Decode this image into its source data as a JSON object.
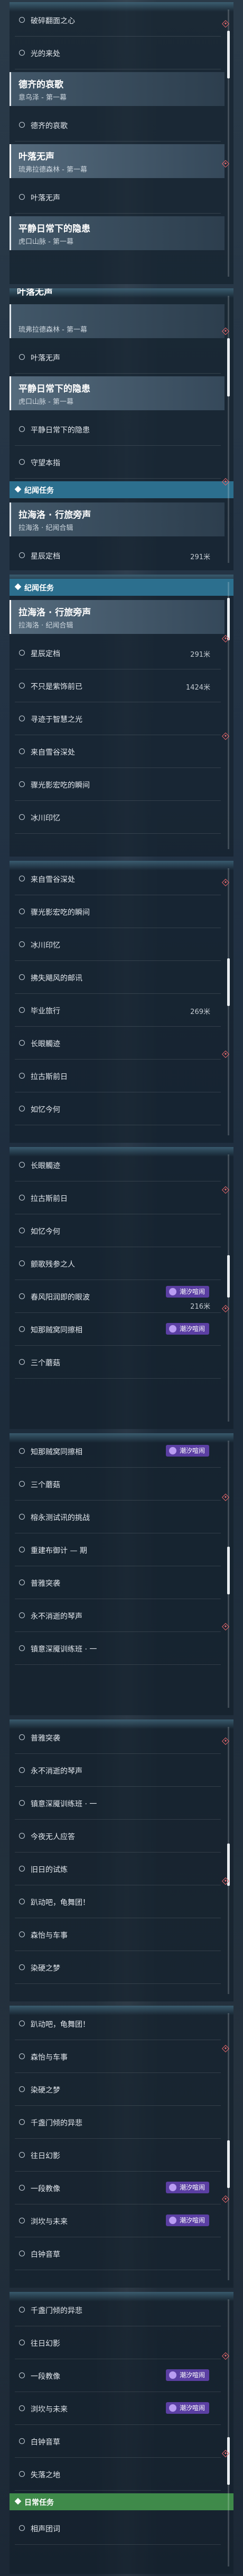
{
  "panels": [
    {
      "id": "p1",
      "rows": [
        {
          "type": "quest",
          "label": "破碎翻面之心"
        },
        {
          "type": "quest",
          "label": "光的来处"
        },
        {
          "type": "card",
          "title": "德齐的哀歌",
          "sub": "意乌泽 - 第一幕",
          "active": false
        },
        {
          "type": "quest",
          "label": "德齐的哀歌"
        },
        {
          "type": "card",
          "title": "叶落无声",
          "sub": "琉弗拉德森林 - 第一幕",
          "active": true
        },
        {
          "type": "quest",
          "label": "叶落无声"
        },
        {
          "type": "card",
          "title": "平静日常下的隐患",
          "sub": "虎口山脉 - 第一幕",
          "active": false
        }
      ]
    },
    {
      "id": "p2",
      "cap": "叶落无声",
      "rows": [
        {
          "type": "card",
          "title": "",
          "sub": "琉弗拉德森林 - 第一幕",
          "active": false
        },
        {
          "type": "quest",
          "label": "叶落无声"
        },
        {
          "type": "card",
          "title": "平静日常下的隐患",
          "sub": "虎口山脉 - 第一幕",
          "active": true
        },
        {
          "type": "quest",
          "label": "平静日常下的隐患"
        },
        {
          "type": "quest",
          "label": "守望本指"
        },
        {
          "type": "header",
          "label": "纪闻任务",
          "color": "blue"
        },
        {
          "type": "card",
          "title": "拉海洛 · 行旅旁声",
          "sub": "拉海洛 · 纪闻合辑",
          "active": false
        },
        {
          "type": "quest",
          "label": "星辰定档",
          "dist": "291米"
        }
      ]
    },
    {
      "id": "p3",
      "rows": [
        {
          "type": "header",
          "label": "纪闻任务",
          "color": "blue"
        },
        {
          "type": "card",
          "title": "拉海洛 · 行旅旁声",
          "sub": "拉海洛 · 纪闻合辑",
          "active": true
        },
        {
          "type": "quest",
          "label": "星辰定档",
          "dist": "291米"
        },
        {
          "type": "quest",
          "label": "不只是紫饰前已",
          "dist": "1424米"
        },
        {
          "type": "quest",
          "label": "寻迹于智慧之光"
        },
        {
          "type": "quest",
          "label": "来自雪谷深处"
        },
        {
          "type": "quest",
          "label": "骤光影宏吃的瞬间"
        },
        {
          "type": "quest",
          "label": "冰川印忆"
        }
      ]
    },
    {
      "id": "p4",
      "rows": [
        {
          "type": "quest",
          "label": "来自雪谷深处"
        },
        {
          "type": "quest",
          "label": "骤光影宏吃的瞬间"
        },
        {
          "type": "quest",
          "label": "冰川印忆"
        },
        {
          "type": "quest",
          "label": "拂失飓风的邮讯"
        },
        {
          "type": "quest",
          "label": "毕业旅行",
          "dist": "269米"
        },
        {
          "type": "quest",
          "label": "长眼觸迹"
        },
        {
          "type": "quest",
          "label": "拉古斯前日"
        },
        {
          "type": "quest",
          "label": "如忆今何"
        }
      ]
    },
    {
      "id": "p5",
      "rows": [
        {
          "type": "quest",
          "label": "长眼觸迹"
        },
        {
          "type": "quest",
          "label": "拉古斯前日"
        },
        {
          "type": "quest",
          "label": "如忆今何"
        },
        {
          "type": "quest",
          "label": "颤歌残参之人"
        },
        {
          "type": "quest",
          "label": "春风阳润即的眼波",
          "badge": "潮汐喧闹",
          "dist": "216米"
        },
        {
          "type": "quest",
          "label": "知那贼窝同擦相",
          "badge": "潮汐喧闹"
        },
        {
          "type": "quest",
          "label": "三个蘑菇"
        }
      ]
    },
    {
      "id": "p6",
      "rows": [
        {
          "type": "quest",
          "label": "知那贼窝同擦相",
          "badge": "潮汐喧闹"
        },
        {
          "type": "quest",
          "label": "三个蘑菇"
        },
        {
          "type": "quest",
          "label": "榕永测试讯的挑战"
        },
        {
          "type": "quest",
          "label": "重建布御计 — 期"
        },
        {
          "type": "quest",
          "label": "普雅突袭"
        },
        {
          "type": "quest",
          "label": "永不消逝的琴声"
        },
        {
          "type": "quest",
          "label": "镇意深魇训练班 · 一"
        }
      ]
    },
    {
      "id": "p7",
      "rows": [
        {
          "type": "quest",
          "label": "普雅突袭"
        },
        {
          "type": "quest",
          "label": "永不消逝的琴声"
        },
        {
          "type": "quest",
          "label": "镇意深魇训练班 · 一"
        },
        {
          "type": "quest",
          "label": "今夜无人应答"
        },
        {
          "type": "quest",
          "label": "旧日的试炼"
        },
        {
          "type": "quest",
          "label": "趴动吧，龟舞团！"
        },
        {
          "type": "quest",
          "label": "森怡与车事"
        },
        {
          "type": "quest",
          "label": "染硬之梦"
        }
      ]
    },
    {
      "id": "p8",
      "rows": [
        {
          "type": "quest",
          "label": "趴动吧，龟舞团！"
        },
        {
          "type": "quest",
          "label": "森怡与车事"
        },
        {
          "type": "quest",
          "label": "染硬之梦"
        },
        {
          "type": "quest",
          "label": "千盏门倾的异悲"
        },
        {
          "type": "quest",
          "label": "往日幻影"
        },
        {
          "type": "quest",
          "label": "一段教像",
          "badge": "潮汐喧闹"
        },
        {
          "type": "quest",
          "label": "浏坎与未来",
          "badge": "潮汐喧闹"
        },
        {
          "type": "quest",
          "label": "白钟音草"
        }
      ]
    },
    {
      "id": "p9",
      "rows": [
        {
          "type": "quest",
          "label": "千盏门倾的异悲"
        },
        {
          "type": "quest",
          "label": "往日幻影"
        },
        {
          "type": "quest",
          "label": "一段教像",
          "badge": "潮汐喧闹"
        },
        {
          "type": "quest",
          "label": "浏坎与未来",
          "badge": "潮汐喧闹"
        },
        {
          "type": "quest",
          "label": "白钟音草"
        },
        {
          "type": "quest",
          "label": "失落之地"
        },
        {
          "type": "header",
          "label": "日常任务",
          "color": "green"
        },
        {
          "type": "quest",
          "label": "相声团词"
        }
      ]
    }
  ]
}
